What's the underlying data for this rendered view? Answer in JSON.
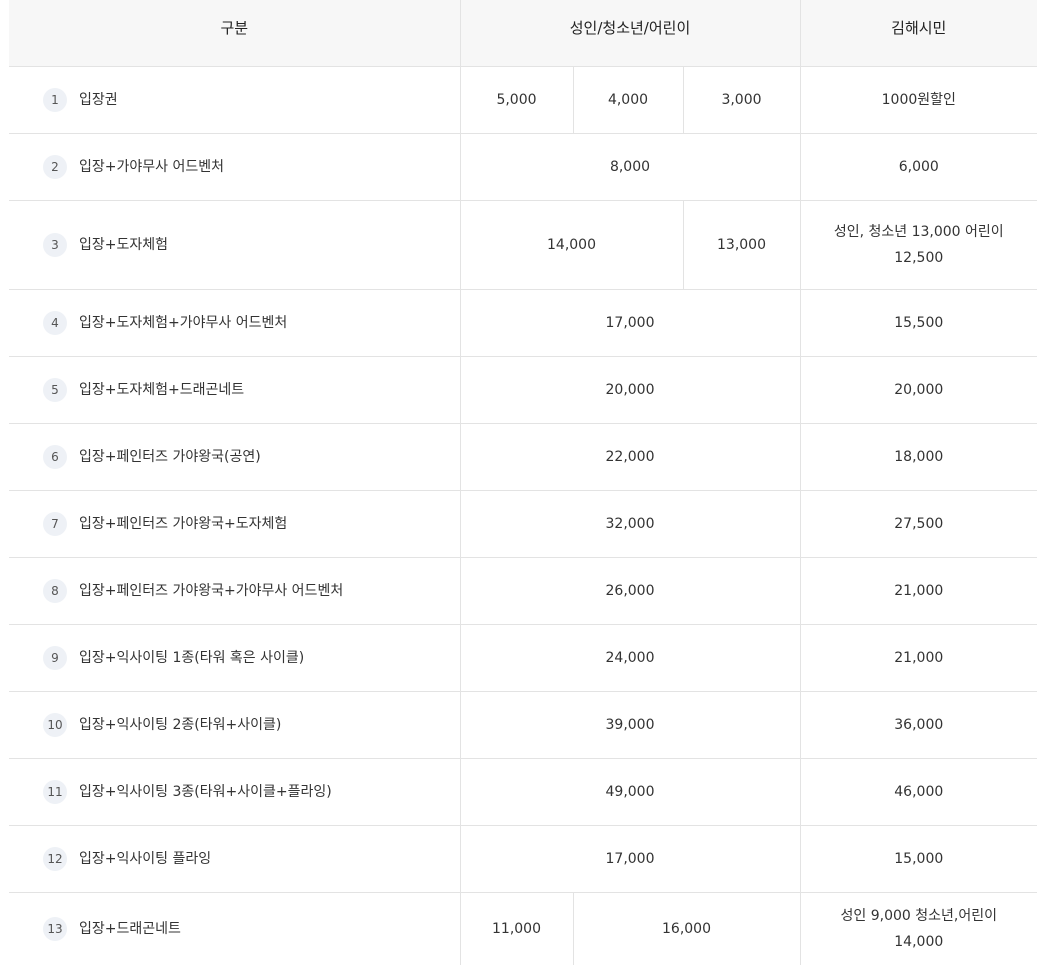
{
  "header": {
    "category": "구분",
    "prices": "성인/청소년/어린이",
    "citizen": "김해시민"
  },
  "rows": [
    {
      "num": "1",
      "name": "입장권",
      "p1": "5,000",
      "p2": "4,000",
      "p3": "3,000",
      "citizen": "1000원할인"
    },
    {
      "num": "2",
      "name": "입장+가야무사 어드벤처",
      "all": "8,000",
      "citizen": "6,000"
    },
    {
      "num": "3",
      "name": "입장+도자체험",
      "p12": "14,000",
      "p3": "13,000",
      "citizen_line1": "성인, 청소년 13,000 어린이",
      "citizen_line2": "12,500"
    },
    {
      "num": "4",
      "name": "입장+도자체험+가야무사 어드벤처",
      "all": "17,000",
      "citizen": "15,500"
    },
    {
      "num": "5",
      "name": "입장+도자체험+드래곤네트",
      "all": "20,000",
      "citizen": "20,000"
    },
    {
      "num": "6",
      "name": "입장+페인터즈 가야왕국(공연)",
      "all": "22,000",
      "citizen": "18,000"
    },
    {
      "num": "7",
      "name": "입장+페인터즈 가야왕국+도자체험",
      "all": "32,000",
      "citizen": "27,500"
    },
    {
      "num": "8",
      "name": "입장+페인터즈 가야왕국+가야무사 어드벤처",
      "all": "26,000",
      "citizen": "21,000"
    },
    {
      "num": "9",
      "name": "입장+익사이팅 1종(타워 혹은 사이클)",
      "all": "24,000",
      "citizen": "21,000"
    },
    {
      "num": "10",
      "name": "입장+익사이팅 2종(타워+사이클)",
      "all": "39,000",
      "citizen": "36,000"
    },
    {
      "num": "11",
      "name": "입장+익사이팅 3종(타워+사이클+플라잉)",
      "all": "49,000",
      "citizen": "46,000"
    },
    {
      "num": "12",
      "name": "입장+익사이팅 플라잉",
      "all": "17,000",
      "citizen": "15,000"
    },
    {
      "num": "13",
      "name": "입장+드래곤네트",
      "p1": "11,000",
      "p23": "16,000",
      "citizen_line1": "성인 9,000 청소년,어린이",
      "citizen_line2": "14,000"
    }
  ]
}
